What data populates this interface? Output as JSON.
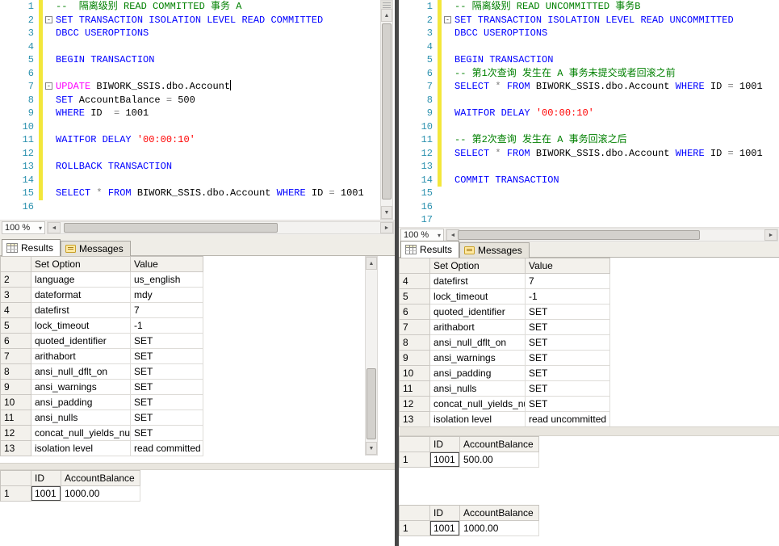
{
  "colors": {
    "comment": "#008000",
    "keyword": "#0000ff",
    "string": "#ff0000",
    "operator": "#808080",
    "identifier": "#000000",
    "line_number": "#2b91af",
    "dml_keyword": "#ff00ff",
    "change_bar": "#f3e73b"
  },
  "left": {
    "zoom_label": "100 %",
    "tabs": [
      {
        "label": "Results"
      },
      {
        "label": "Messages"
      }
    ],
    "editor": {
      "lines": [
        {
          "n": "1",
          "chg": true,
          "tokens": [
            [
              "--  隔离级别 READ COMMITTED 事务 A",
              "c"
            ]
          ]
        },
        {
          "n": "2",
          "chg": true,
          "fold": true,
          "tokens": [
            [
              "SET TRANSACTION ISOLATION LEVEL READ COMMITTED",
              "k"
            ]
          ]
        },
        {
          "n": "3",
          "chg": true,
          "tokens": [
            [
              "DBCC USEROPTIONS",
              "k"
            ]
          ]
        },
        {
          "n": "4",
          "chg": true,
          "tokens": []
        },
        {
          "n": "5",
          "chg": true,
          "tokens": [
            [
              "BEGIN TRANSACTION",
              "k"
            ]
          ]
        },
        {
          "n": "6",
          "chg": true,
          "tokens": []
        },
        {
          "n": "7",
          "chg": true,
          "fold": true,
          "caret": true,
          "tokens": [
            [
              "UPDATE",
              "m"
            ],
            [
              " BIWORK_SSIS.dbo.Account",
              "d"
            ]
          ]
        },
        {
          "n": "8",
          "chg": true,
          "tokens": [
            [
              "SET",
              "k"
            ],
            [
              " AccountBalance ",
              "d"
            ],
            [
              "=",
              "o"
            ],
            [
              " 500",
              "d"
            ]
          ]
        },
        {
          "n": "9",
          "chg": true,
          "tokens": [
            [
              "WHERE",
              "k"
            ],
            [
              " ID  ",
              "d"
            ],
            [
              "=",
              "o"
            ],
            [
              " 1001",
              "d"
            ]
          ]
        },
        {
          "n": "10",
          "chg": true,
          "tokens": []
        },
        {
          "n": "11",
          "chg": true,
          "tokens": [
            [
              "WAITFOR DELAY ",
              "k"
            ],
            [
              "'00:00:10'",
              "s"
            ]
          ]
        },
        {
          "n": "12",
          "chg": true,
          "tokens": []
        },
        {
          "n": "13",
          "chg": true,
          "tokens": [
            [
              "ROLLBACK TRANSACTION",
              "k"
            ]
          ]
        },
        {
          "n": "14",
          "chg": true,
          "tokens": []
        },
        {
          "n": "15",
          "chg": true,
          "tokens": [
            [
              "SELECT ",
              "k"
            ],
            [
              "*",
              "o"
            ],
            [
              " ",
              "d"
            ],
            [
              "FROM",
              "k"
            ],
            [
              " BIWORK_SSIS.dbo.Account ",
              "d"
            ],
            [
              "WHERE",
              "k"
            ],
            [
              " ID ",
              "d"
            ],
            [
              "=",
              "o"
            ],
            [
              " 1001",
              "d"
            ]
          ]
        },
        {
          "n": "16",
          "chg": false,
          "tokens": []
        }
      ]
    },
    "grid_options": {
      "columns": [
        "Set Option",
        "Value"
      ],
      "rows": [
        {
          "n": "2",
          "cells": [
            "language",
            "us_english"
          ]
        },
        {
          "n": "3",
          "cells": [
            "dateformat",
            "mdy"
          ]
        },
        {
          "n": "4",
          "cells": [
            "datefirst",
            "7"
          ]
        },
        {
          "n": "5",
          "cells": [
            "lock_timeout",
            "-1"
          ]
        },
        {
          "n": "6",
          "cells": [
            "quoted_identifier",
            "SET"
          ]
        },
        {
          "n": "7",
          "cells": [
            "arithabort",
            "SET"
          ]
        },
        {
          "n": "8",
          "cells": [
            "ansi_null_dflt_on",
            "SET"
          ]
        },
        {
          "n": "9",
          "cells": [
            "ansi_warnings",
            "SET"
          ]
        },
        {
          "n": "10",
          "cells": [
            "ansi_padding",
            "SET"
          ]
        },
        {
          "n": "11",
          "cells": [
            "ansi_nulls",
            "SET"
          ]
        },
        {
          "n": "12",
          "cells": [
            "concat_null_yields_null",
            "SET"
          ]
        },
        {
          "n": "13",
          "cells": [
            "isolation level",
            "read committed"
          ]
        }
      ]
    },
    "grid_account": {
      "columns": [
        "ID",
        "AccountBalance"
      ],
      "rows": [
        {
          "n": "1",
          "cells": [
            "1001",
            "1000.00"
          ],
          "focus": 0
        }
      ]
    }
  },
  "right": {
    "zoom_label": "100 %",
    "tabs": [
      {
        "label": "Results"
      },
      {
        "label": "Messages"
      }
    ],
    "editor": {
      "lines": [
        {
          "n": "1",
          "chg": true,
          "tokens": [
            [
              "-- 隔离级别 READ UNCOMMITTED 事务B",
              "c"
            ]
          ]
        },
        {
          "n": "2",
          "chg": true,
          "fold": true,
          "tokens": [
            [
              "SET TRANSACTION ISOLATION LEVEL READ UNCOMMITTED",
              "k"
            ]
          ]
        },
        {
          "n": "3",
          "chg": true,
          "tokens": [
            [
              "DBCC USEROPTIONS",
              "k"
            ]
          ]
        },
        {
          "n": "4",
          "chg": true,
          "tokens": []
        },
        {
          "n": "5",
          "chg": true,
          "tokens": [
            [
              "BEGIN TRANSACTION",
              "k"
            ]
          ]
        },
        {
          "n": "6",
          "chg": true,
          "tokens": [
            [
              "-- 第1次查询 发生在 A 事务未提交或者回滚之前",
              "c"
            ]
          ]
        },
        {
          "n": "7",
          "chg": true,
          "tokens": [
            [
              "SELECT ",
              "k"
            ],
            [
              "*",
              "o"
            ],
            [
              " ",
              "d"
            ],
            [
              "FROM",
              "k"
            ],
            [
              " BIWORK_SSIS.dbo.Account ",
              "d"
            ],
            [
              "WHERE",
              "k"
            ],
            [
              " ID ",
              "d"
            ],
            [
              "=",
              "o"
            ],
            [
              " 1001",
              "d"
            ]
          ]
        },
        {
          "n": "8",
          "chg": true,
          "tokens": []
        },
        {
          "n": "9",
          "chg": true,
          "tokens": [
            [
              "WAITFOR DELAY ",
              "k"
            ],
            [
              "'00:00:10'",
              "s"
            ]
          ]
        },
        {
          "n": "10",
          "chg": true,
          "tokens": []
        },
        {
          "n": "11",
          "chg": true,
          "tokens": [
            [
              "-- 第2次查询 发生在 A 事务回滚之后",
              "c"
            ]
          ]
        },
        {
          "n": "12",
          "chg": true,
          "tokens": [
            [
              "SELECT ",
              "k"
            ],
            [
              "*",
              "o"
            ],
            [
              " ",
              "d"
            ],
            [
              "FROM",
              "k"
            ],
            [
              " BIWORK_SSIS.dbo.Account ",
              "d"
            ],
            [
              "WHERE",
              "k"
            ],
            [
              " ID ",
              "d"
            ],
            [
              "=",
              "o"
            ],
            [
              " 1001",
              "d"
            ]
          ]
        },
        {
          "n": "13",
          "chg": true,
          "tokens": []
        },
        {
          "n": "14",
          "chg": true,
          "tokens": [
            [
              "COMMIT TRANSACTION",
              "k"
            ]
          ]
        },
        {
          "n": "15",
          "chg": false,
          "tokens": []
        },
        {
          "n": "16",
          "chg": false,
          "tokens": []
        },
        {
          "n": "17",
          "chg": false,
          "tokens": []
        }
      ]
    },
    "grid_options": {
      "columns": [
        "Set Option",
        "Value"
      ],
      "rows": [
        {
          "n": "4",
          "cells": [
            "datefirst",
            "7"
          ]
        },
        {
          "n": "5",
          "cells": [
            "lock_timeout",
            "-1"
          ]
        },
        {
          "n": "6",
          "cells": [
            "quoted_identifier",
            "SET"
          ]
        },
        {
          "n": "7",
          "cells": [
            "arithabort",
            "SET"
          ]
        },
        {
          "n": "8",
          "cells": [
            "ansi_null_dflt_on",
            "SET"
          ]
        },
        {
          "n": "9",
          "cells": [
            "ansi_warnings",
            "SET"
          ]
        },
        {
          "n": "10",
          "cells": [
            "ansi_padding",
            "SET"
          ]
        },
        {
          "n": "11",
          "cells": [
            "ansi_nulls",
            "SET"
          ]
        },
        {
          "n": "12",
          "cells": [
            "concat_null_yields_null",
            "SET"
          ]
        },
        {
          "n": "13",
          "cells": [
            "isolation level",
            "read uncommitted"
          ]
        }
      ]
    },
    "grid_account_1": {
      "columns": [
        "ID",
        "AccountBalance"
      ],
      "rows": [
        {
          "n": "1",
          "cells": [
            "1001",
            "500.00"
          ],
          "focus": 0
        }
      ]
    },
    "grid_account_2": {
      "columns": [
        "ID",
        "AccountBalance"
      ],
      "rows": [
        {
          "n": "1",
          "cells": [
            "1001",
            "1000.00"
          ],
          "focus": 0
        }
      ]
    }
  }
}
